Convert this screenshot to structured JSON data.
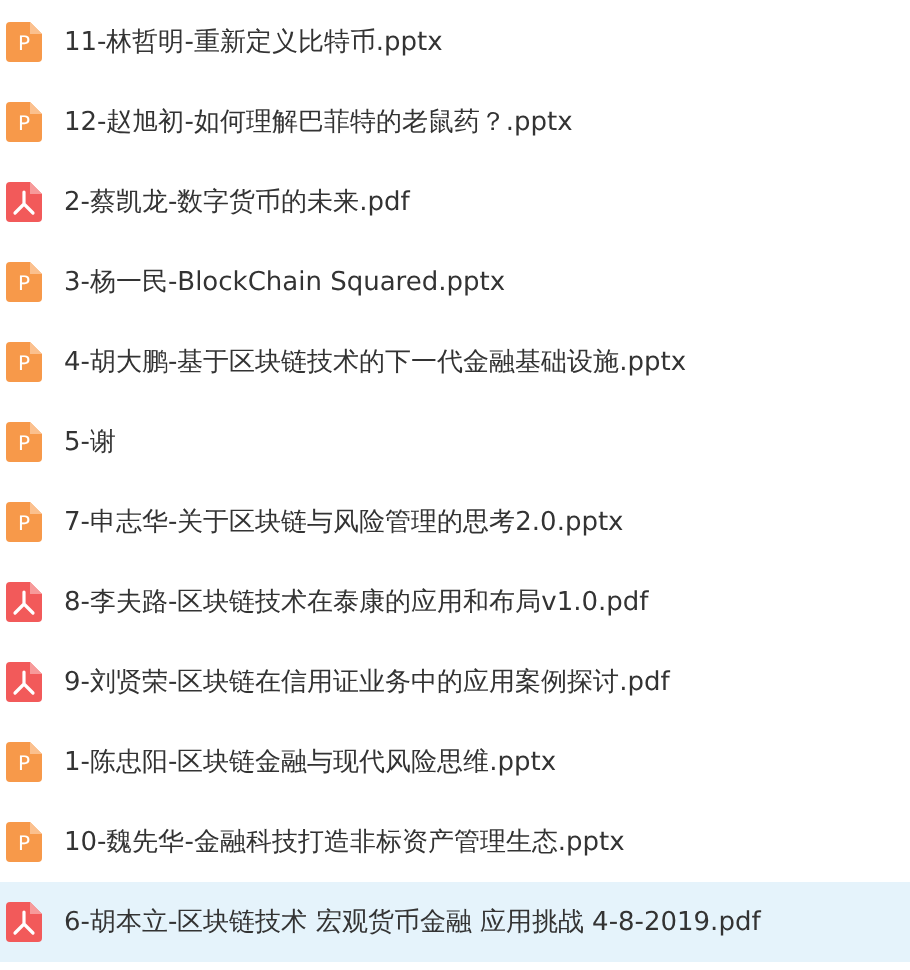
{
  "files": [
    {
      "name": "11-林哲明-重新定义比特币.pptx",
      "kind": "pptx",
      "icon_text": "P",
      "selected": false
    },
    {
      "name": "12-赵旭初-如何理解巴菲特的老鼠药？.pptx",
      "kind": "pptx",
      "icon_text": "P",
      "selected": false
    },
    {
      "name": "2-蔡凯龙-数字货币的未来.pdf",
      "kind": "pdf",
      "selected": false
    },
    {
      "name": "3-杨一民-BlockChain Squared.pptx",
      "kind": "pptx",
      "icon_text": "P",
      "selected": false
    },
    {
      "name": "4-胡大鹏-基于区块链技术的下一代金融基础设施.pptx",
      "kind": "pptx",
      "icon_text": "P",
      "selected": false
    },
    {
      "name": "5-谢",
      "kind": "pptx",
      "icon_text": "P",
      "selected": false
    },
    {
      "name": "7-申志华-关于区块链与风险管理的思考2.0.pptx",
      "kind": "pptx",
      "icon_text": "P",
      "selected": false
    },
    {
      "name": "8-李夫路-区块链技术在泰康的应用和布局v1.0.pdf",
      "kind": "pdf",
      "selected": false
    },
    {
      "name": "9-刘贤荣-区块链在信用证业务中的应用案例探讨.pdf",
      "kind": "pdf",
      "selected": false
    },
    {
      "name": "1-陈忠阳-区块链金融与现代风险思维.pptx",
      "kind": "pptx",
      "icon_text": "P",
      "selected": false
    },
    {
      "name": "10-魏先华-金融科技打造非标资产管理生态.pptx",
      "kind": "pptx",
      "icon_text": "P",
      "selected": false
    },
    {
      "name": "6-胡本立-区块链技术 宏观货币金融 应用挑战 4-8-2019.pdf",
      "kind": "pdf",
      "selected": true
    }
  ]
}
